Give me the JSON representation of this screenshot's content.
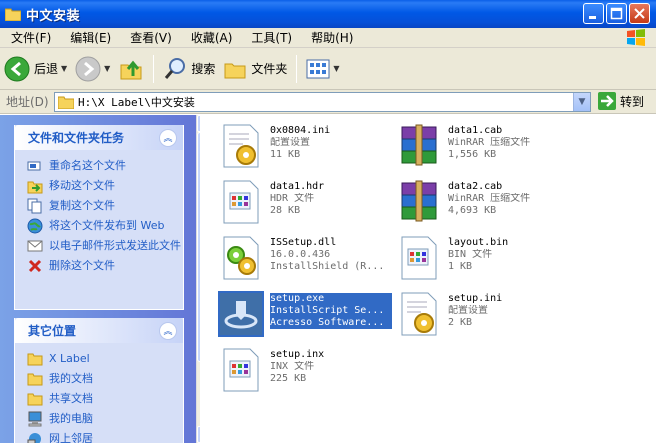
{
  "window": {
    "title": "中文安装"
  },
  "menu": [
    "文件(F)",
    "编辑(E)",
    "查看(V)",
    "收藏(A)",
    "工具(T)",
    "帮助(H)"
  ],
  "toolbar": {
    "back": "后退",
    "search": "搜索",
    "folders": "文件夹"
  },
  "address": {
    "label": "地址(D)",
    "path": "H:\\X Label\\中文安装",
    "go": "转到"
  },
  "tasks_panel": {
    "title": "文件和文件夹任务",
    "items": [
      {
        "label": "重命名这个文件",
        "icon": "rename-icon"
      },
      {
        "label": "移动这个文件",
        "icon": "move-icon"
      },
      {
        "label": "复制这个文件",
        "icon": "copy-icon"
      },
      {
        "label": "将这个文件发布到 Web",
        "icon": "web-publish-icon"
      },
      {
        "label": "以电子邮件形式发送此文件",
        "icon": "email-icon"
      },
      {
        "label": "删除这个文件",
        "icon": "delete-icon"
      }
    ]
  },
  "places_panel": {
    "title": "其它位置",
    "items": [
      {
        "label": "X Label",
        "icon": "folder-icon"
      },
      {
        "label": "我的文档",
        "icon": "folder-icon"
      },
      {
        "label": "共享文档",
        "icon": "folder-icon"
      },
      {
        "label": "我的电脑",
        "icon": "computer-icon"
      },
      {
        "label": "网上邻居",
        "icon": "network-icon"
      }
    ]
  },
  "files": [
    {
      "name": "0x0804.ini",
      "type": "配置设置",
      "info": "11 KB",
      "icon": "config-file-icon",
      "selected": false
    },
    {
      "name": "data1.cab",
      "type": "WinRAR 压缩文件",
      "info": "1,556 KB",
      "icon": "winrar-archive-icon",
      "selected": false
    },
    {
      "name": "data1.hdr",
      "type": "HDR 文件",
      "info": "28 KB",
      "icon": "generic-file-icon",
      "selected": false
    },
    {
      "name": "data2.cab",
      "type": "WinRAR 压缩文件",
      "info": "4,693 KB",
      "icon": "winrar-archive-icon",
      "selected": false
    },
    {
      "name": "ISSetup.dll",
      "type": "16.0.0.436",
      "info": "InstallShield (R...",
      "icon": "dll-file-icon",
      "selected": false
    },
    {
      "name": "layout.bin",
      "type": "BIN 文件",
      "info": "1 KB",
      "icon": "generic-file-icon",
      "selected": false
    },
    {
      "name": "setup.exe",
      "type": "InstallScript Se...",
      "info": "Acresso Software...",
      "icon": "installer-icon",
      "selected": true
    },
    {
      "name": "setup.ini",
      "type": "配置设置",
      "info": "2 KB",
      "icon": "config-file-icon",
      "selected": false
    },
    {
      "name": "setup.inx",
      "type": "INX 文件",
      "info": "225 KB",
      "icon": "generic-file-icon",
      "selected": false
    }
  ]
}
